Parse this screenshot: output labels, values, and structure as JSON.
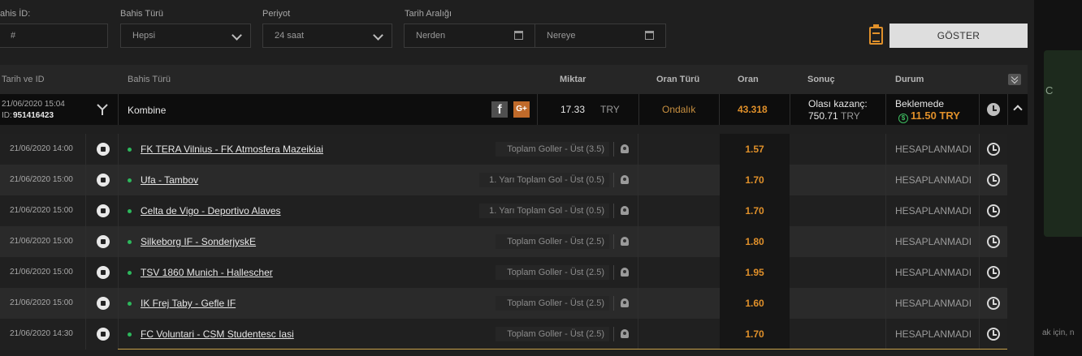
{
  "filters": {
    "bet_id": {
      "label": "ahis İD:",
      "placeholder": "#"
    },
    "bet_type": {
      "label": "Bahis Türü",
      "value": "Hepsi"
    },
    "period": {
      "label": "Periyot",
      "value": "24 saat"
    },
    "date_range": {
      "label": "Tarih Aralığı",
      "from_placeholder": "Nerden",
      "to_placeholder": "Nereye"
    },
    "show_button": "GÖSTER"
  },
  "table_headers": {
    "date_id": "Tarih ve ID",
    "bet_type": "Bahis Türü",
    "amount": "Miktar",
    "odd_type": "Oran Türü",
    "odd": "Oran",
    "result": "Sonuç",
    "status": "Durum"
  },
  "bet": {
    "datetime": "21/06/2020 15:04",
    "id_label": "ID:",
    "id": "951416423",
    "type": "Kombine",
    "facebook": "f",
    "google_plus": "G+",
    "amount": "17.33",
    "currency": "TRY",
    "odd_type": "Ondalık",
    "odd": "43.318",
    "possible_win_label": "Olası kazanç:",
    "possible_win_value": "750.71",
    "possible_win_currency": "TRY",
    "status": "Beklemede",
    "cashout": "11.50 TRY"
  },
  "events": [
    {
      "date": "21/06/2020 14:00",
      "match": "FK TERA Vilnius - FK Atmosfera Mazeikiai",
      "market": "Toplam Goller - Üst (3.5)",
      "odd": "1.57",
      "status": "HESAPLANMADI"
    },
    {
      "date": "21/06/2020 15:00",
      "match": "Ufa - Tambov",
      "market": "1. Yarı Toplam Gol - Üst (0.5)",
      "odd": "1.70",
      "status": "HESAPLANMADI"
    },
    {
      "date": "21/06/2020 15:00",
      "match": "Celta de Vigo - Deportivo Alaves",
      "market": "1. Yarı Toplam Gol - Üst (0.5)",
      "odd": "1.70",
      "status": "HESAPLANMADI"
    },
    {
      "date": "21/06/2020 15:00",
      "match": "Silkeborg IF - SonderjyskE",
      "market": "Toplam Goller - Üst (2.5)",
      "odd": "1.80",
      "status": "HESAPLANMADI"
    },
    {
      "date": "21/06/2020 15:00",
      "match": "TSV 1860 Munich - Hallescher",
      "market": "Toplam Goller - Üst (2.5)",
      "odd": "1.95",
      "status": "HESAPLANMADI"
    },
    {
      "date": "21/06/2020 15:00",
      "match": "IK Frej Taby - Gefle IF",
      "market": "Toplam Goller - Üst (2.5)",
      "odd": "1.60",
      "status": "HESAPLANMADI"
    },
    {
      "date": "21/06/2020 14:30",
      "match": "FC Voluntari - CSM Studentesc Iasi",
      "market": "Toplam Goller - Üst (2.5)",
      "odd": "1.70",
      "status": "HESAPLANMADI"
    }
  ],
  "side_panel": {
    "letter": "C",
    "bottom_text": "ak için, n"
  },
  "colors": {
    "accent_orange": "#e0902a",
    "green_status": "#2db85c",
    "button_bg": "#dedede"
  }
}
